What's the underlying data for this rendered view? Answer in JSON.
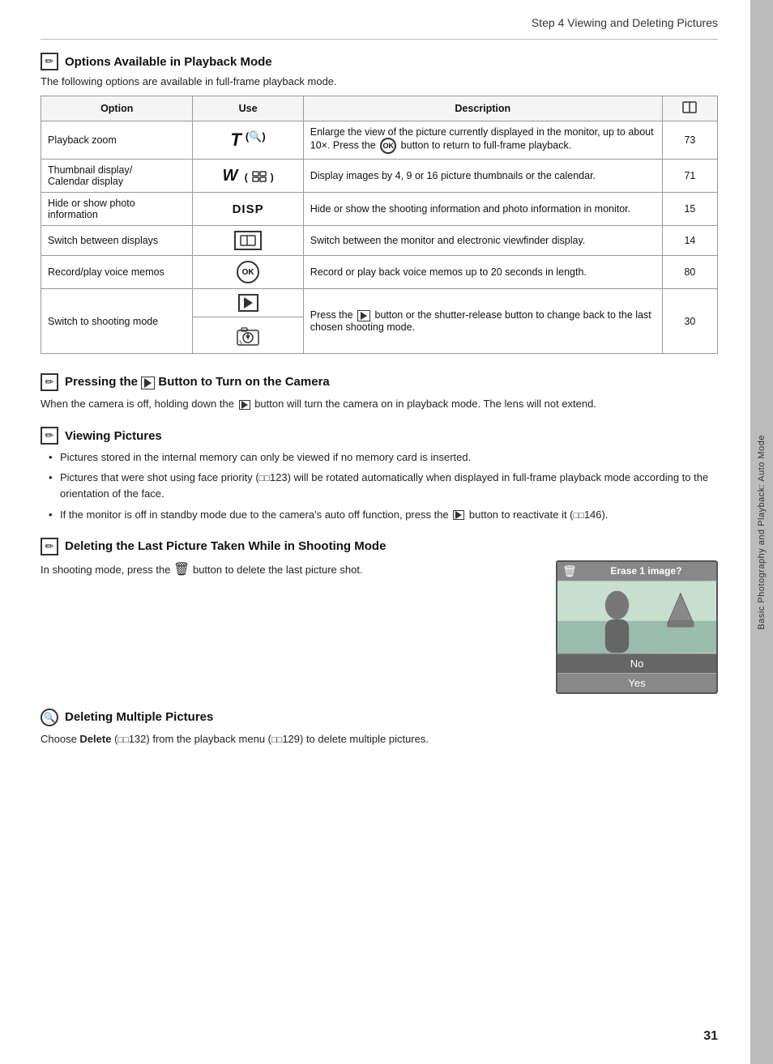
{
  "header": {
    "title": "Step 4 Viewing and Deleting Pictures"
  },
  "sidebar": {
    "label": "Basic Photography and Playback: Auto Mode"
  },
  "page_number": "31",
  "section1": {
    "title": "Options Available in Playback Mode",
    "subtitle": "The following options are available in full-frame playback mode.",
    "table": {
      "headers": [
        "Option",
        "Use",
        "Description",
        ""
      ],
      "rows": [
        {
          "option": "Playback zoom",
          "use_type": "T",
          "description": "Enlarge the view of the picture currently displayed in the monitor, up to about 10×. Press the  button to return to full-frame playback.",
          "ref": "73"
        },
        {
          "option": "Thumbnail display/\nCalendar display",
          "use_type": "W",
          "description": "Display images by 4, 9 or 16 picture thumbnails or the calendar.",
          "ref": "71"
        },
        {
          "option": "Hide or show photo information",
          "use_type": "DISP",
          "description": "Hide or show the shooting information and photo information in monitor.",
          "ref": "15"
        },
        {
          "option": "Switch between displays",
          "use_type": "MONITOR",
          "description": "Switch between the monitor and electronic viewfinder display.",
          "ref": "14"
        },
        {
          "option": "Record/play voice memos",
          "use_type": "OK",
          "description": "Record or play back voice memos up to 20 seconds in length.",
          "ref": "80"
        },
        {
          "option": "Switch to shooting mode",
          "use_type": "PLAY+SHUTTER",
          "description": "Press the  button or the shutter-release button to change back to the last chosen shooting mode.",
          "ref": "30"
        }
      ]
    }
  },
  "section2": {
    "title": "Pressing the  Button to Turn on the Camera",
    "body": "When the camera is off, holding down the  button will turn the camera on in playback mode. The lens will not extend."
  },
  "section3": {
    "title": "Viewing Pictures",
    "bullets": [
      "Pictures stored in the internal memory can only be viewed if no memory card is inserted.",
      "Pictures that were shot using face priority (  123) will be rotated automatically when displayed in full-frame playback mode according to the orientation of the face.",
      "If the monitor is off in standby mode due to the camera's auto off function, press the  button to reactivate it (  146)."
    ]
  },
  "section4": {
    "title": "Deleting the Last Picture Taken While in Shooting Mode",
    "body": "In shooting mode, press the  button to delete the last picture shot.",
    "screen": {
      "top_text": "Erase 1 image?",
      "no_label": "No",
      "yes_label": "Yes"
    }
  },
  "section5": {
    "title": "Deleting Multiple Pictures",
    "body": "Choose Delete (  132) from the playback menu (  129) to delete multiple pictures."
  }
}
